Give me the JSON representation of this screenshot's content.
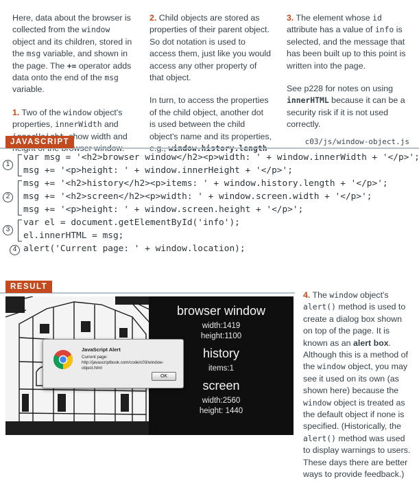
{
  "col1": {
    "p1_a": "Here, data about the browser is collected from the ",
    "p1_code1": "window",
    "p1_b": " object and its children, stored in the ",
    "p1_code2": "msg",
    "p1_c": " variable, and shown in the page. The ",
    "p1_code3": "+=",
    "p1_d": " operator adds data onto the end of the ",
    "p1_code4": "msg",
    "p1_e": " variable.",
    "p2_num": "1.",
    "p2_a": " Two of the ",
    "p2_code1": "window",
    "p2_b": " object's properties, ",
    "p2_code2": "innerWidth",
    "p2_c": " and ",
    "p2_code3": "innerHeight",
    "p2_d": ", show width and height of the browser window."
  },
  "col2": {
    "p1_num": "2.",
    "p1_a": " Child objects are stored as properties of their parent object. So dot notation is used to access them, just like you would access any other property of that object.",
    "p2_a": "In turn, to access the properties of the child object, another dot is used between the child object's name and its properties, e.g., ",
    "p2_code": "window.history.length"
  },
  "col3": {
    "p1_num": "3.",
    "p1_a": " The element whose ",
    "p1_code": "id",
    "p1_b": " attribute has a value of ",
    "p1_code2": "info",
    "p1_c": " is selected, and the message that has been built up to this point is written into the page.",
    "p2_a": "See p228 for notes on using ",
    "p2_code": "innerHTML",
    "p2_b": " because it can be a security risk if it is not used correctly."
  },
  "js_header": {
    "label": "JAVASCRIPT",
    "filepath": "c03/js/window-object.js"
  },
  "code": [
    "var msg = '<h2>browser window</h2><p>width: ' + window.innerWidth + '</p>';",
    "msg += '<p>height: ' + window.innerHeight + '</p>';",
    "msg += '<h2>history</h2><p>items: ' + window.history.length + '</p>';",
    "msg += '<h2>screen</h2><p>width: ' + window.screen.width + '</p>';",
    "msg += '<p>height: ' + window.screen.height + '</p>';",
    "var el = document.getElementById('info');",
    "el.innerHTML = msg;",
    "alert('Current page: ' + window.location);"
  ],
  "markers": [
    "1",
    "2",
    "3",
    "4"
  ],
  "result_header": {
    "label": "RESULT"
  },
  "result": {
    "h_browser": "browser window",
    "width1": "width:1419",
    "height1": "height:1100",
    "h_history": "history",
    "items": "items:1",
    "h_screen": "screen",
    "width2": "width:2560",
    "height2": "height: 1440",
    "dialog_title": "JavaScript Alert",
    "dialog_msg": "Current page: http://javascriptbook.com/code/c03/window-object.html",
    "dialog_ok": "OK"
  },
  "side": {
    "num": "4.",
    "a": " The ",
    "code1": "window",
    "b": " object's ",
    "code2": "alert()",
    "c": " method is used to create a dialog box shown on top of the page. It is known as an ",
    "bold": "alert box",
    "d": ". Although this is a method of the ",
    "code3": "window",
    "e": " object, you may see it used on its own (as shown here) because the ",
    "code4": "window",
    "f": " object is treated as the default object if none is specified. (Historically, the ",
    "code5": "alert()",
    "g": " method was used to display warnings to users. These days there are better ways to provide feedback.)"
  },
  "colors": {
    "accent": "#c24a1e",
    "text": "#36414a",
    "rule": "#b6c2c9"
  }
}
